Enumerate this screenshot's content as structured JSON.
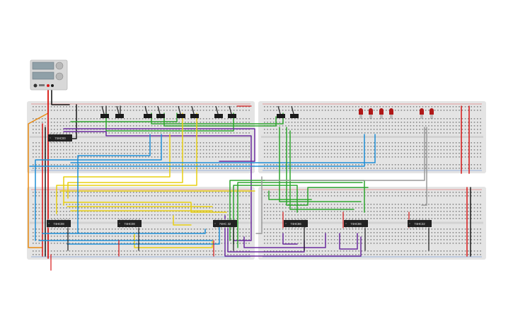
{
  "power_supply": {
    "name": "bench-power-supply"
  },
  "chips": [
    {
      "label": "74HC00"
    },
    {
      "label": "74HC08"
    },
    {
      "label": "74HC08"
    },
    {
      "label": "74HC 32"
    },
    {
      "label": "74HC86"
    },
    {
      "label": "74HC86"
    },
    {
      "label": "74HC32"
    }
  ],
  "leds": {
    "count": 6,
    "color": "#b01818"
  },
  "switches": {
    "count": 10,
    "color": "#1a1a1a"
  },
  "wire_colors": {
    "red": "#d81818",
    "black": "#1a1a1a",
    "blue": "#1e8fd6",
    "green": "#2ea52e",
    "yellow": "#e8cf12",
    "purple": "#6b2b9e",
    "orange": "#e88a12",
    "gray": "#9a9a9a"
  },
  "breadboard": {
    "body": "#e4e4e4",
    "hole": "#8a8a8a",
    "rail_red": "#e05050",
    "rail_blue": "#5080d0"
  }
}
